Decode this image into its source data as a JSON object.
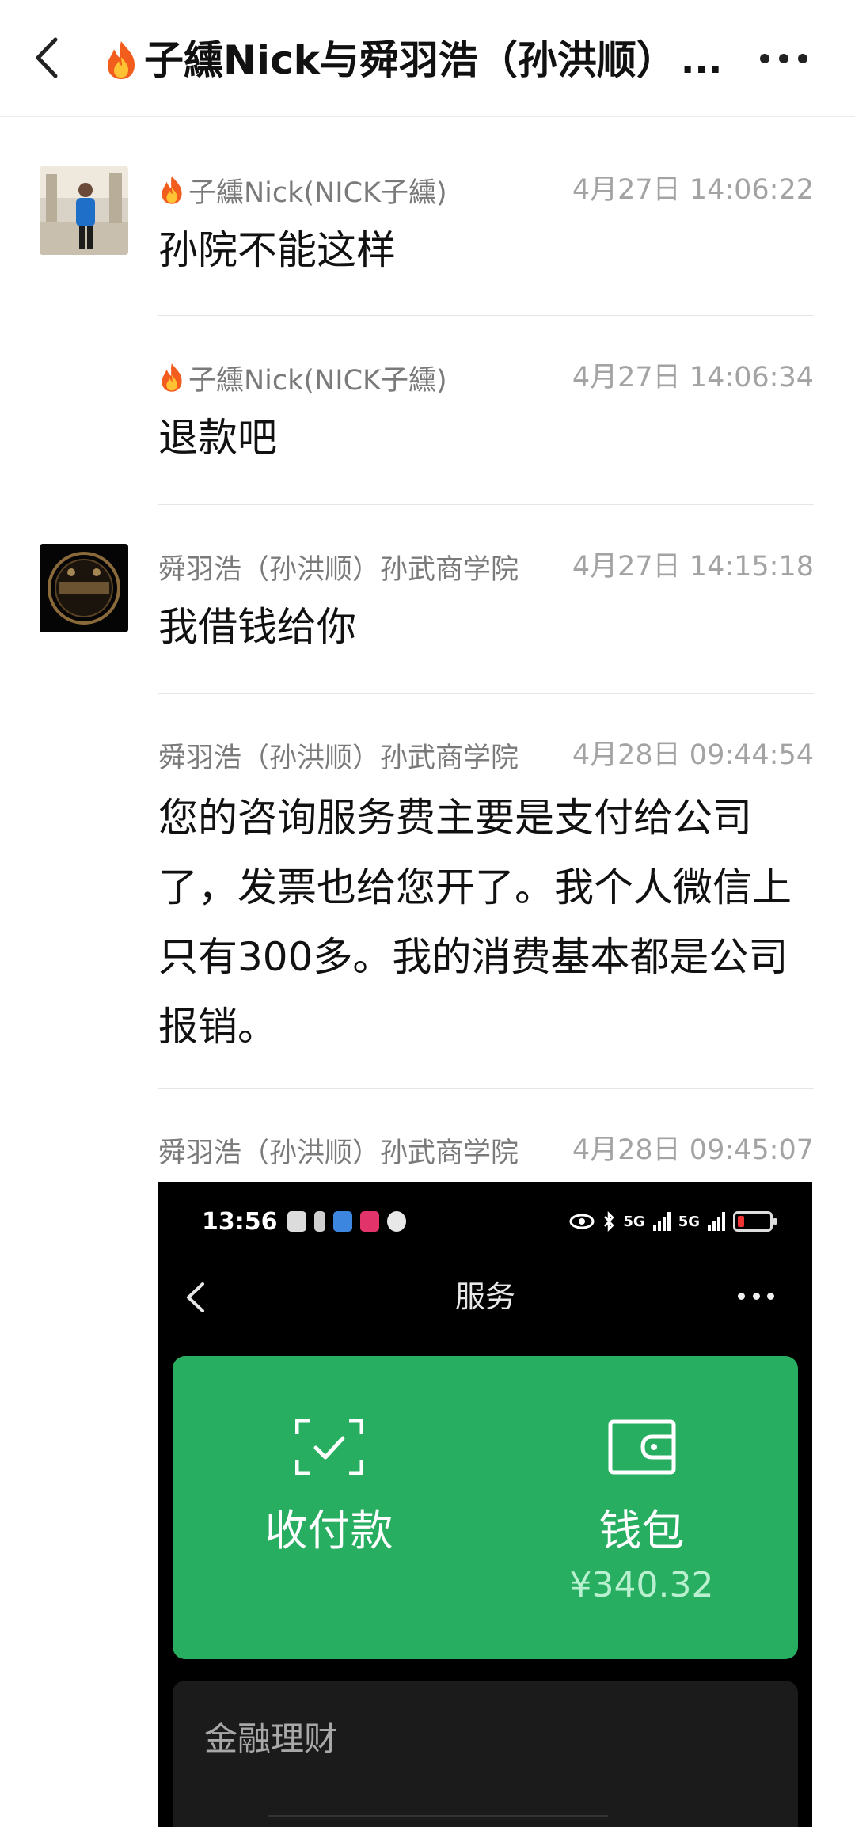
{
  "header": {
    "title": "子纁Nick与舜羽浩（孙洪顺）",
    "ellipsis": "..."
  },
  "messages": [
    {
      "sender": "子纁Nick(NICK子纁)",
      "time": "4月27日 14:06:22",
      "text": "孙院不能这样"
    },
    {
      "sender": "子纁Nick(NICK子纁)",
      "time": "4月27日 14:06:34",
      "text": "退款吧"
    },
    {
      "sender": "舜羽浩（孙洪顺）孙武商学院",
      "time": "4月27日 14:15:18",
      "text": "我借钱给你"
    },
    {
      "sender": "舜羽浩（孙洪顺）孙武商学院",
      "time": "4月28日 09:44:54",
      "text": "您的咨询服务费主要是支付给公司了，发票也给您开了。我个人微信上只有300多。我的消费基本都是公司报销。"
    },
    {
      "sender": "舜羽浩（孙洪顺）孙武商学院",
      "time": "4月28日 09:45:07",
      "text": ""
    }
  ],
  "screenshot": {
    "status_time": "13:56",
    "signal_1": "5G",
    "signal_2": "5G",
    "page_title": "服务",
    "pay_label": "收付款",
    "wallet_label": "钱包",
    "wallet_balance": "¥340.32",
    "section_title": "金融理财"
  },
  "colors": {
    "accent_green": "#27ae60",
    "timestamp_gray": "#a3a3a3",
    "sender_gray": "#7a7a7a"
  },
  "icons": [
    "back-arrow-icon",
    "fire-icon",
    "more-icon",
    "wechat-avatar",
    "scan-check-icon",
    "wallet-icon"
  ]
}
